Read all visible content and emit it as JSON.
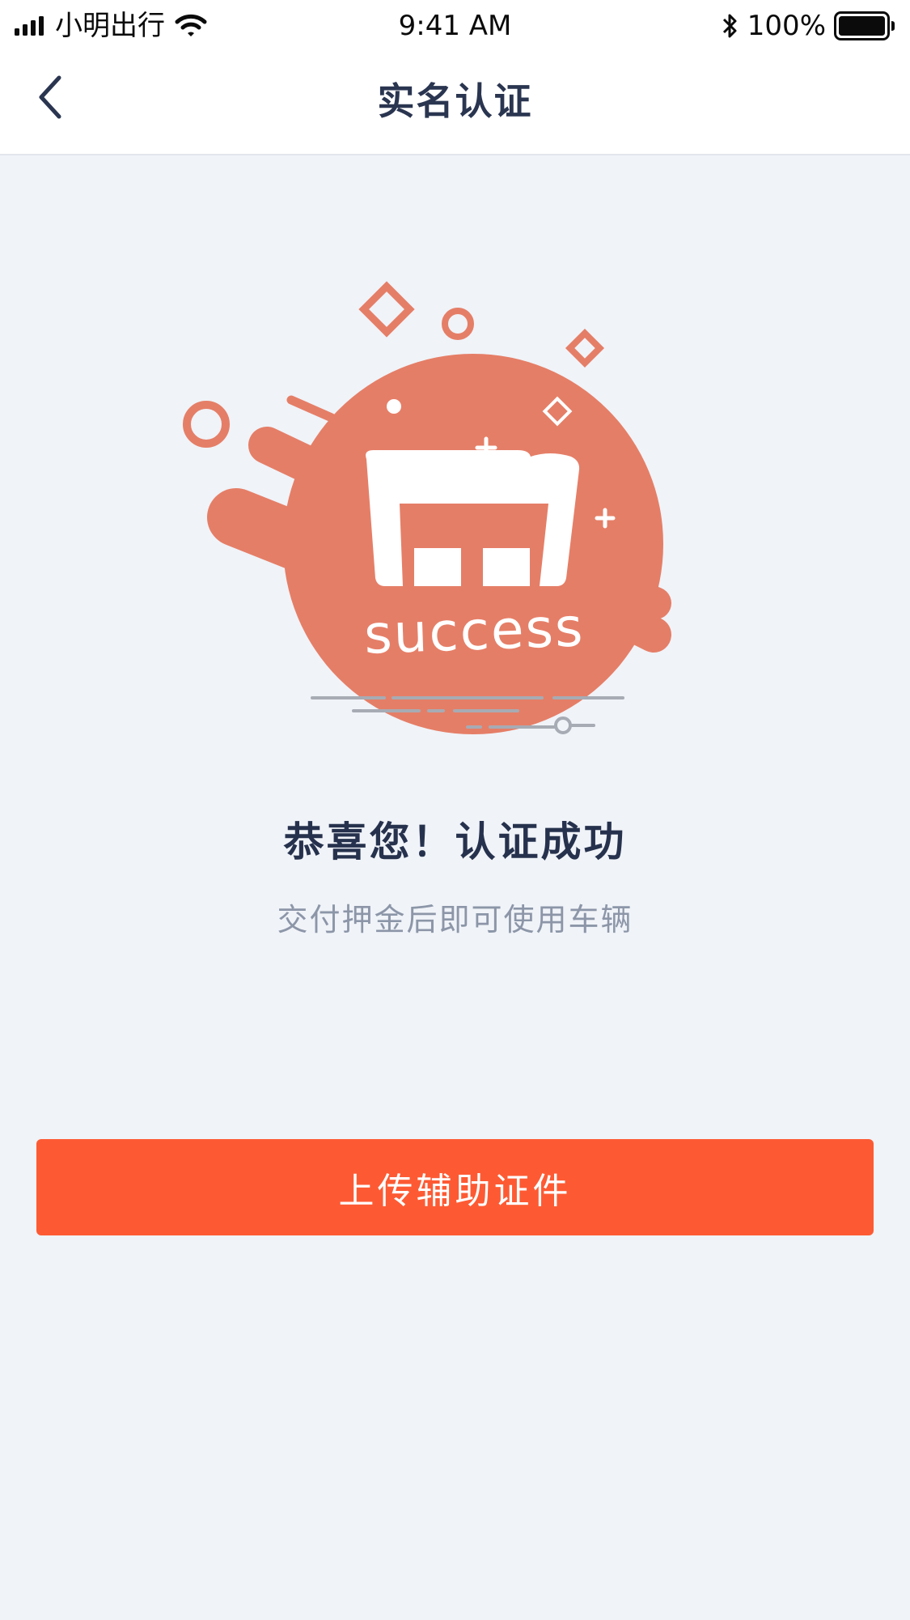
{
  "status_bar": {
    "carrier": "小明出行",
    "time": "9:41 AM",
    "battery_percent": "100%",
    "icons": [
      "signal-icon",
      "wifi-icon",
      "bluetooth-icon",
      "battery-icon"
    ]
  },
  "nav": {
    "title": "实名认证",
    "back_icon": "chevron-left-icon"
  },
  "illustration": {
    "label": "success",
    "accent_color": "#E57E67"
  },
  "result": {
    "title": "恭喜您！认证成功",
    "subtitle": "交付押金后即可使用车辆"
  },
  "actions": {
    "primary_label": "上传辅助证件"
  },
  "colors": {
    "primary": "#FD5A33",
    "background": "#F0F3F8",
    "title_text": "#26324D",
    "subtitle_text": "#8C96A8"
  }
}
